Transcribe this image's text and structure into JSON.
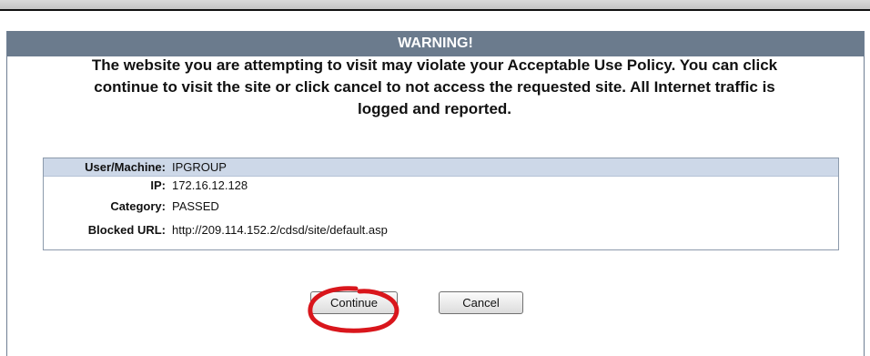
{
  "header": {
    "title": "WARNING!"
  },
  "message": {
    "line1": "The website you are attempting to visit may violate your Acceptable Use Policy. You can click",
    "line2": "continue to visit the site or click cancel to not access the requested site. All Internet traffic is",
    "line3": "logged and reported."
  },
  "info": {
    "rows": [
      {
        "label": "User/Machine:",
        "value": "IPGROUP"
      },
      {
        "label": "IP:",
        "value": "172.16.12.128"
      },
      {
        "label": "Category:",
        "value": "PASSED"
      },
      {
        "label": "Blocked URL:",
        "value": "http://209.114.152.2/cdsd/site/default.asp"
      }
    ]
  },
  "buttons": {
    "continue_label": "Continue",
    "cancel_label": "Cancel"
  },
  "colors": {
    "header_bg": "#6b7b8d",
    "info_highlight": "#cdd8e8",
    "annotation": "#d9161c"
  }
}
